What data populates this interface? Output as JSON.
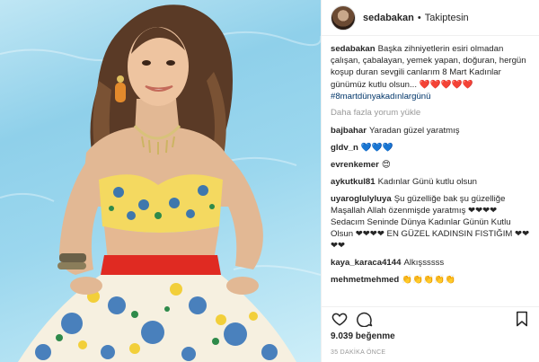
{
  "post": {
    "author": "sedabakan",
    "follow_status": "Takiptesin",
    "separator": "•"
  },
  "caption": {
    "user": "sedabakan",
    "text": "Başka zihniyetlerin esiri olmadan çalışan, çabalayan, yemek yapan, doğuran, hergün koşup duran sevgili canlarım 8 Mart Kadınlar günümüz kutlu olsun... ❤️❤️❤️❤️❤️",
    "hashtag": "#8martdünyakadınlargünü"
  },
  "load_more": "Daha fazla yorum yükle",
  "comments": [
    {
      "user": "bajbahar",
      "text": "Yaradan güzel yaratmış"
    },
    {
      "user": "gldv_n",
      "text": "💙💙💙"
    },
    {
      "user": "evrenkemer",
      "text": "😍"
    },
    {
      "user": "aykutkul81",
      "text": "Kadınlar Günü kutlu olsun"
    },
    {
      "user": "uyaroglulyluya",
      "text": "Şu güzelliğe bak şu güzelliğe Maşallah Allah özenmişde yaratmış ❤❤❤❤ Sedacım Seninde Dünya Kadınlar Günün Kutlu Olsun ❤❤❤❤ EN GÜZEL KADINSIN FISTIĞIM ❤❤❤❤"
    },
    {
      "user": "kaya_karaca4144",
      "text": "Alkışsssss"
    },
    {
      "user": "mehmetmehmed",
      "text": "👏👏👏👏👏"
    }
  ],
  "icons": {
    "like": "heart-icon",
    "comment": "comment-icon",
    "save": "bookmark-icon"
  },
  "likes": "9.039 beğenme",
  "timestamp": "35 DAKİKA ÖNCE",
  "colors": {
    "text": "#262626",
    "link": "#003569",
    "muted": "#999999",
    "border": "#efefef"
  }
}
